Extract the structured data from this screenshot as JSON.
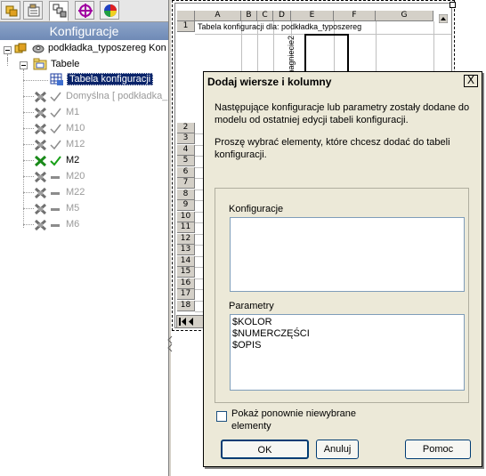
{
  "feature_manager": {
    "tabs": [
      {
        "name": "feature-tree"
      },
      {
        "name": "properties"
      },
      {
        "name": "configurations"
      },
      {
        "name": "dimxpert"
      },
      {
        "name": "display"
      }
    ],
    "header": "Konfiguracje",
    "root_label": "podkładka_typoszereg Kon",
    "tables_label": "Tabele",
    "table_item_label": "Tabela konfiguracji",
    "configurations": [
      {
        "label": "Domyślna [ podkładka_",
        "active": false
      },
      {
        "label": "M1",
        "active": false
      },
      {
        "label": "M10",
        "active": false
      },
      {
        "label": "M12",
        "active": false
      },
      {
        "label": "M2",
        "active": true
      },
      {
        "label": "M20",
        "active": false
      },
      {
        "label": "M22",
        "active": false
      },
      {
        "label": "M5",
        "active": false
      },
      {
        "label": "M6",
        "active": false
      }
    ]
  },
  "spreadsheet": {
    "columns": [
      "A",
      "B",
      "C",
      "D",
      "E",
      "F",
      "G"
    ],
    "rows": [
      "1",
      "2",
      "3",
      "4",
      "5",
      "6",
      "7",
      "8",
      "9",
      "10",
      "11",
      "12",
      "13",
      "14",
      "15",
      "16",
      "17",
      "18"
    ],
    "cell_a1": "Tabela konfiguracji dla: podkładka_typoszereg",
    "cell_d2": "$nagniecie2"
  },
  "dialog": {
    "title": "Dodaj wiersze i kolumny",
    "close_glyph": "X",
    "message1": "Następujące konfiguracje lub parametry zostały dodane do modelu od ostatniej edycji tabeli konfiguracji.",
    "message2": "Proszę wybrać elementy, które chcesz dodać do tabeli konfiguracji.",
    "configurations_label": "Konfiguracje",
    "configurations_items": [],
    "parameters_label": "Parametry",
    "parameters_items": [
      "$KOLOR",
      "$NUMERCZĘŚCI",
      "$OPIS"
    ],
    "show_again_label": "Pokaż ponownie niewybrane elementy",
    "ok_label": "OK",
    "cancel_label": "Anuluj",
    "help_label": "Pomoc"
  }
}
